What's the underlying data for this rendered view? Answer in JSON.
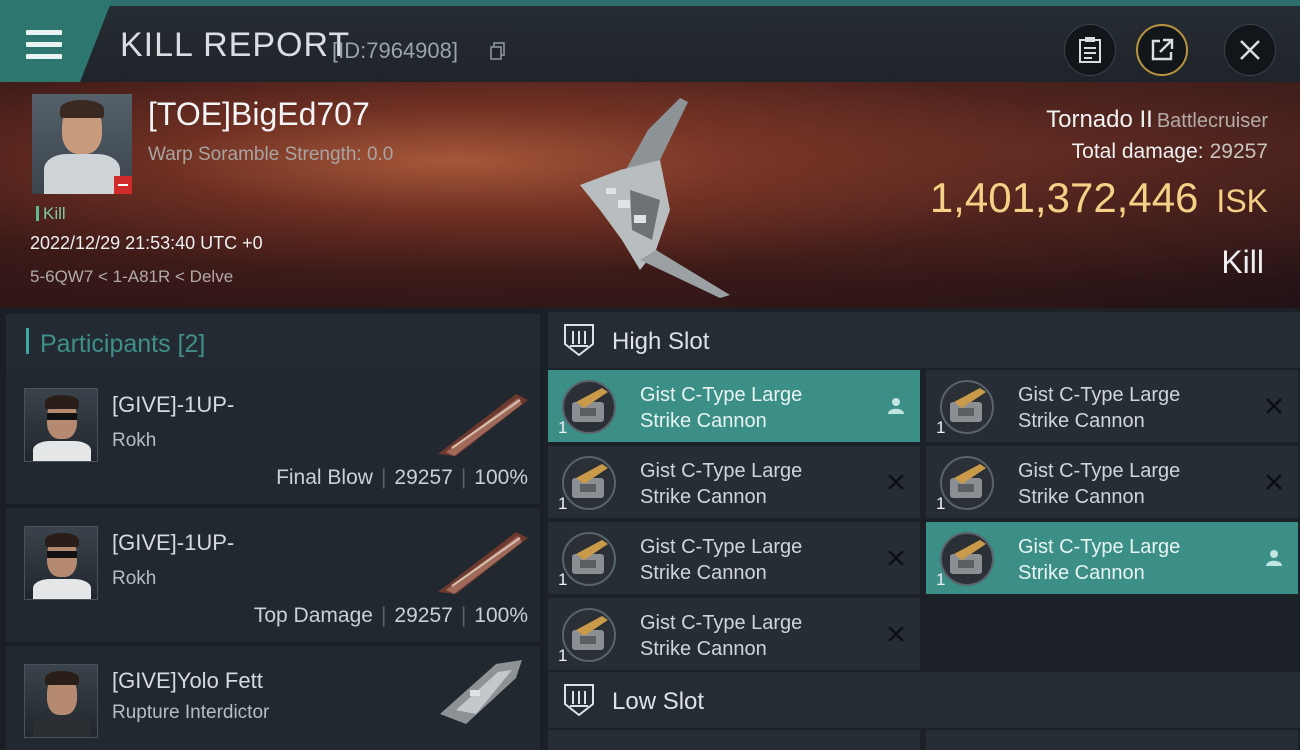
{
  "header": {
    "title": "KILL REPORT",
    "id_text": "[ID:7964908]"
  },
  "banner": {
    "pilot_name": "[TOE]BigEd707",
    "warp_scramble": "Warp Soramble Strength: 0.0",
    "kill_tag": "Kill",
    "datetime": "2022/12/29 21:53:40 UTC +0",
    "location": "5-6QW7 < 1-A81R < Delve",
    "ship_name": "Tornado II",
    "ship_class": "Battlecruiser",
    "total_damage_label": "Total damage:",
    "total_damage_value": "29257",
    "isk_value": "1,401,372,446",
    "isk_unit": "ISK",
    "result": "Kill"
  },
  "participants": {
    "header": "Participants [2]",
    "rows": [
      {
        "name": "[GIVE]-1UP-",
        "ship": "Rokh",
        "role": "Final Blow",
        "damage": "29257",
        "percent": "100%"
      },
      {
        "name": "[GIVE]-1UP-",
        "ship": "Rokh",
        "role": "Top Damage",
        "damage": "29257",
        "percent": "100%"
      },
      {
        "name": "[GIVE]Yolo Fett",
        "ship": "Rupture Interdictor",
        "badge": "i"
      }
    ]
  },
  "slots": {
    "high_label": "High Slot",
    "low_label": "Low Slot",
    "modules": [
      {
        "line1": "Gist C-Type Large",
        "line2": "Strike Cannon",
        "qty": "1",
        "state": "user-icon"
      },
      {
        "line1": "Gist C-Type Large",
        "line2": "Strike Cannon",
        "qty": "1",
        "state": "x-icon"
      },
      {
        "line1": "Gist C-Type Large",
        "line2": "Strike Cannon",
        "qty": "1",
        "state": "x-icon"
      },
      {
        "line1": "Gist C-Type Large",
        "line2": "Strike Cannon",
        "qty": "1",
        "state": "x-icon"
      },
      {
        "line1": "Gist C-Type Large",
        "line2": "Strike Cannon",
        "qty": "1",
        "state": "x-icon"
      },
      {
        "line1": "Gist C-Type Large",
        "line2": "Strike Cannon",
        "qty": "1",
        "state": "user-icon"
      },
      {
        "line1": "Gist C-Type Large",
        "line2": "Strike Cannon",
        "qty": "1",
        "state": "x-icon"
      }
    ]
  },
  "colors": {
    "accent": "#3b8f86",
    "isk": "#f4d186",
    "danger": "#d12a2a"
  }
}
